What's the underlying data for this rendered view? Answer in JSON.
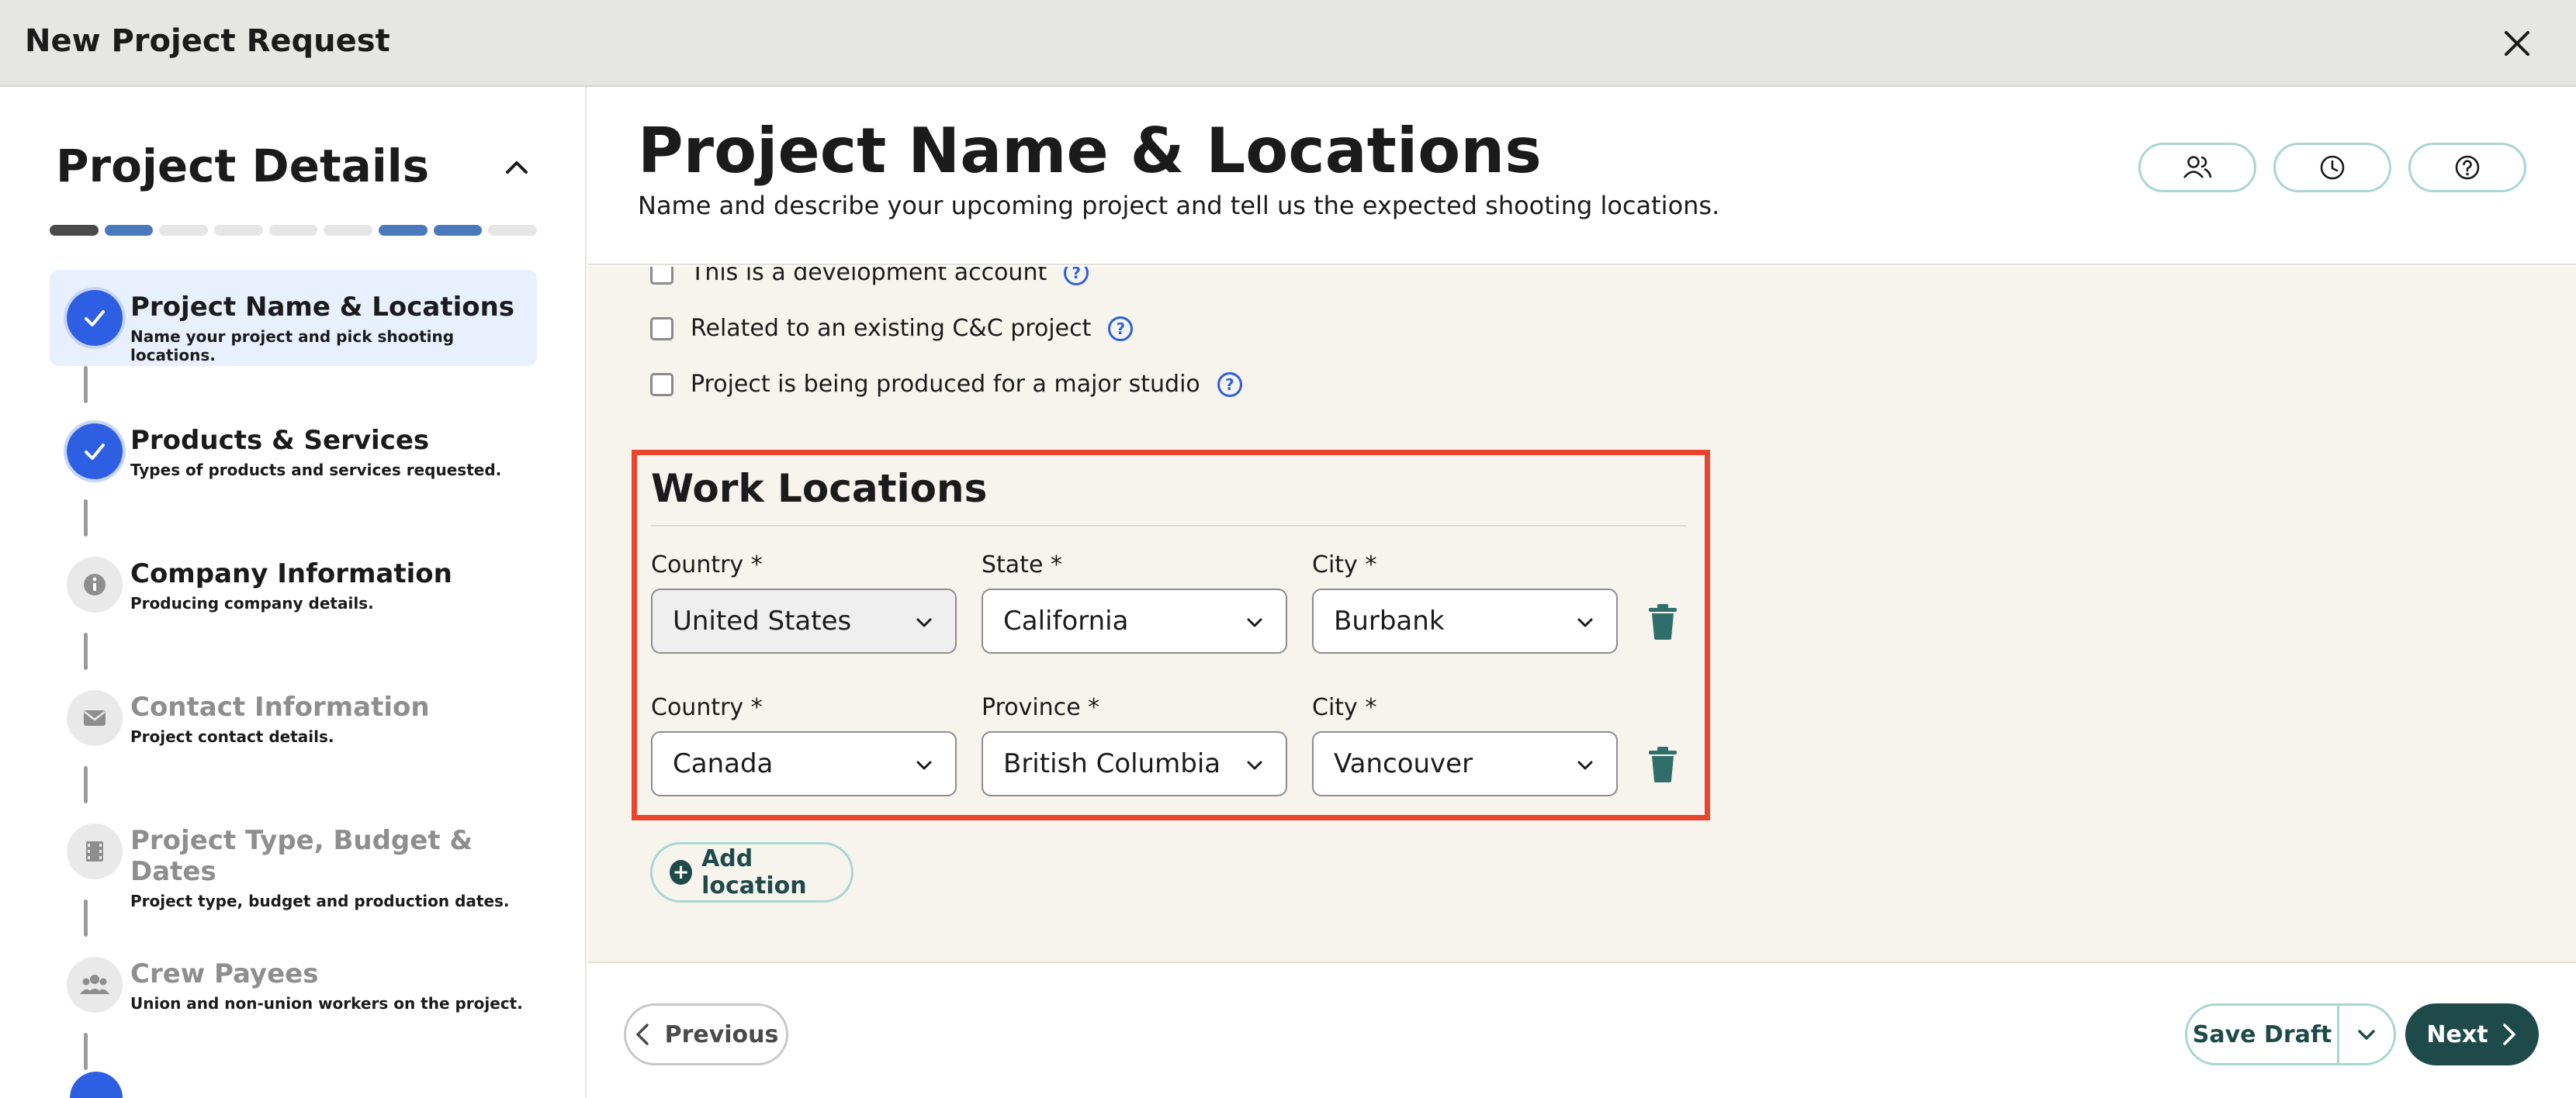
{
  "window": {
    "title": "New Project Request"
  },
  "sidebar": {
    "title": "Project Details",
    "progress": [
      "done",
      "blue",
      "todo",
      "todo",
      "todo",
      "todo",
      "blue",
      "blue",
      "todo"
    ],
    "steps": [
      {
        "title": "Project Name & Locations",
        "sub": "Name your project and pick shooting locations.",
        "state": "active",
        "icon": "check-icon"
      },
      {
        "title": "Products & Services",
        "sub": "Types of products and services requested.",
        "state": "done",
        "icon": "check-icon"
      },
      {
        "title": "Company Information",
        "sub": "Producing company details.",
        "state": "pending",
        "icon": "info-icon"
      },
      {
        "title": "Contact Information",
        "sub": "Project contact details.",
        "state": "muted",
        "icon": "mail-icon"
      },
      {
        "title": "Project Type, Budget & Dates",
        "sub": "Project type, budget and production dates.",
        "state": "muted",
        "icon": "film-icon"
      },
      {
        "title": "Crew Payees",
        "sub": "Union and non-union workers on the project.",
        "state": "muted",
        "icon": "people-icon"
      }
    ]
  },
  "main": {
    "title": "Project Name & Locations",
    "subtitle": "Name and describe your upcoming project and tell us the expected shooting locations.",
    "checkboxes": [
      {
        "label": "This is a development account",
        "checked": false
      },
      {
        "label": "Related to an existing C&C project",
        "checked": false
      },
      {
        "label": "Project is being produced for a major studio",
        "checked": false
      }
    ],
    "work_locations": {
      "title": "Work Locations",
      "rows": [
        {
          "country_label": "Country *",
          "country": "United States",
          "region_label": "State *",
          "region": "California",
          "city_label": "City *",
          "city": "Burbank"
        },
        {
          "country_label": "Country *",
          "country": "Canada",
          "region_label": "Province *",
          "region": "British Columbia",
          "city_label": "City *",
          "city": "Vancouver"
        }
      ]
    },
    "add_location_label": "Add location"
  },
  "footer": {
    "previous_label": "Previous",
    "save_draft_label": "Save Draft",
    "next_label": "Next"
  },
  "colors": {
    "accent_blue": "#2e5fe3",
    "highlight_red": "#e8452c",
    "teal_dark": "#1f4a4a",
    "teal_light": "#a9d6d1"
  }
}
